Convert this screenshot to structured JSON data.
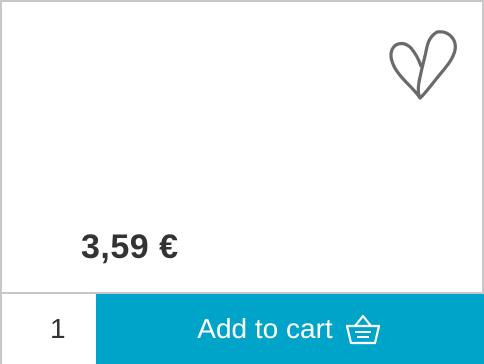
{
  "product": {
    "price": "3,59 €"
  },
  "cart": {
    "quantity": "1",
    "add_label": "Add to cart"
  },
  "icons": {
    "favorite": "heart-outline-icon",
    "cart": "basket-icon"
  },
  "colors": {
    "accent": "#00a4c8",
    "text": "#333333",
    "border": "#c8c8c8",
    "icon": "#6a6a6a"
  }
}
